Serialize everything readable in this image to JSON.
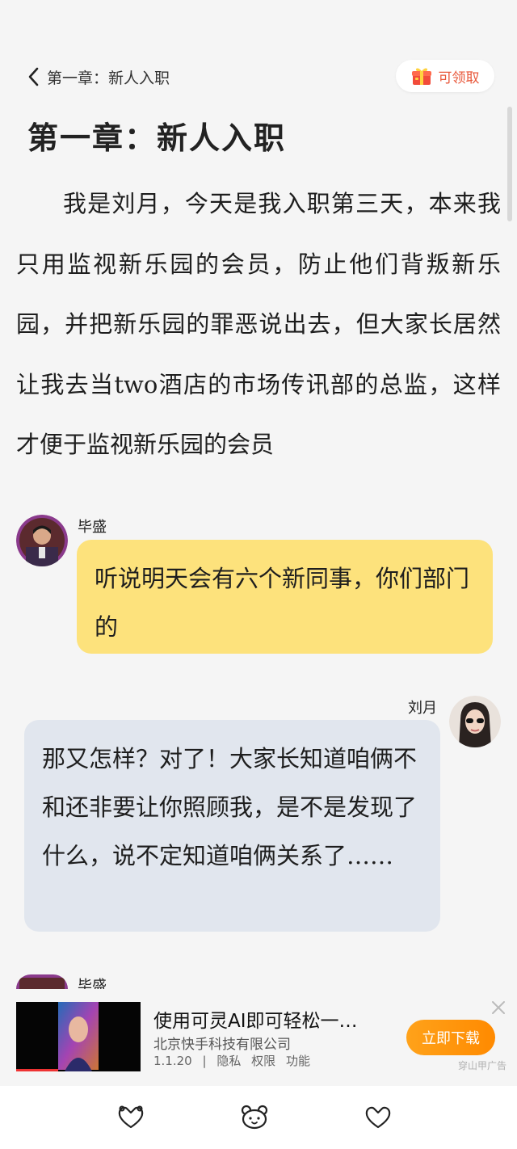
{
  "header": {
    "back_label": "第一章：新人入职",
    "reward_label": "可领取"
  },
  "chapter": {
    "title": "第一章：新人入职",
    "narration": "我是刘月，今天是我入职第三天，本来我只用监视新乐园的会员，防止他们背叛新乐园，并把新乐园的罪恶说出去，但大家长居然让我去当two酒店的市场传讯部的总监，这样才便于监视新乐园的会员"
  },
  "messages": [
    {
      "speaker": "毕盛",
      "side": "left",
      "text": "听说明天会有六个新同事，你们部门的"
    },
    {
      "speaker": "刘月",
      "side": "right",
      "text": "那又怎样？对了！大家长知道咱俩不和还非要让你照顾我，是不是发现了什么，说不定知道咱俩关系了……"
    },
    {
      "speaker": "毕盛",
      "side": "left",
      "text": ""
    }
  ],
  "ad": {
    "title": "使用可灵AI即可轻松一…",
    "company": "北京快手科技有限公司",
    "version": "1.1.20",
    "links": [
      "隐私",
      "权限",
      "功能"
    ],
    "cta": "立即下载",
    "tag": "穿山甲广告"
  },
  "bottom_bar": {
    "icons": [
      "heart-paws-icon",
      "bear-face-icon",
      "heart-icon"
    ]
  },
  "colors": {
    "background": "#f5f5f5",
    "bubble_left": "#fde27c",
    "bubble_right": "#e1e6ee",
    "accent": "#e8573a",
    "cta": "#ff9a0e"
  }
}
